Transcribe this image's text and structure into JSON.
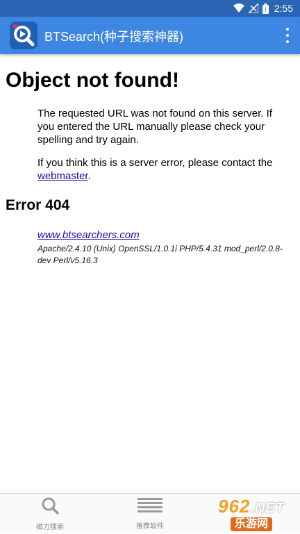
{
  "status_bar": {
    "time": "2:55",
    "icons": [
      "wifi-icon",
      "signal-icon",
      "battery-icon"
    ]
  },
  "app_bar": {
    "title": "BTSearch(种子搜索神器)",
    "icon": "search-app-logo",
    "menu_icon": "more-vert-icon"
  },
  "page": {
    "title": "Object not found!",
    "message_1": "The requested URL was not found on this server. If you entered the URL manually please check your spelling and try again.",
    "message_2_prefix": "If you think this is a server error, please contact the ",
    "webmaster_link": "webmaster",
    "message_2_suffix": ".",
    "error_heading": "Error 404",
    "site_link": "www.btsearchers.com",
    "server_info": "Apache/2.4.10 (Unix) OpenSSL/1.0.1i PHP/5.4.31 mod_perl/2.0.8-dev Perl/v5.16.3"
  },
  "bottom_nav": {
    "items": [
      {
        "label": "磁力搜索",
        "icon": "search-icon"
      },
      {
        "label": "推荐软件",
        "icon": "list-icon"
      }
    ]
  },
  "watermark": {
    "top": "962",
    "top_suffix": ".NET",
    "bottom": "乐游网"
  },
  "colors": {
    "app_bar": "#3d86e1",
    "status_bar": "#2a66b3",
    "link": "#1a0dab"
  }
}
